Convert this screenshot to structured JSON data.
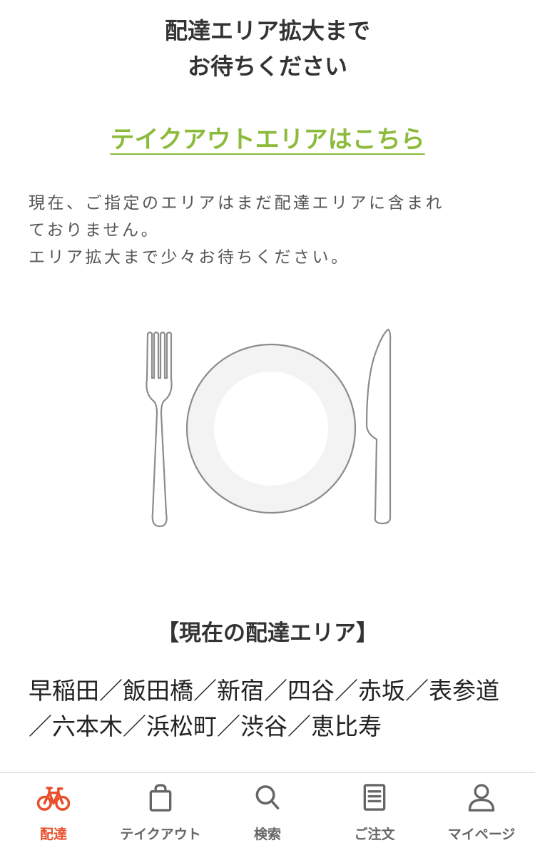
{
  "header": {
    "title_line1": "配達エリア拡大まで",
    "title_line2": "お待ちください"
  },
  "takeout_link": "テイクアウトエリアはこちら",
  "message": {
    "line1": "現在、ご指定のエリアはまだ配達エリアに含まれ",
    "line2": "ておりません。",
    "line3": "エリア拡大まで少々お待ちください。"
  },
  "delivery_area": {
    "heading": "【現在の配達エリア】",
    "list": "早稲田／飯田橋／新宿／四谷／赤坂／表参道／六本木／浜松町／渋谷／恵比寿"
  },
  "colors": {
    "accent": "#e8502b",
    "link": "#8cbb3c",
    "icon_inactive": "#666666"
  },
  "tabbar": {
    "active": "delivery",
    "tabs": [
      {
        "id": "delivery",
        "label": "配達",
        "icon": "bicycle-icon"
      },
      {
        "id": "takeout",
        "label": "テイクアウト",
        "icon": "shopping-bag-icon"
      },
      {
        "id": "search",
        "label": "検索",
        "icon": "search-icon"
      },
      {
        "id": "orders",
        "label": "ご注文",
        "icon": "document-icon"
      },
      {
        "id": "mypage",
        "label": "マイページ",
        "icon": "user-icon"
      }
    ]
  }
}
